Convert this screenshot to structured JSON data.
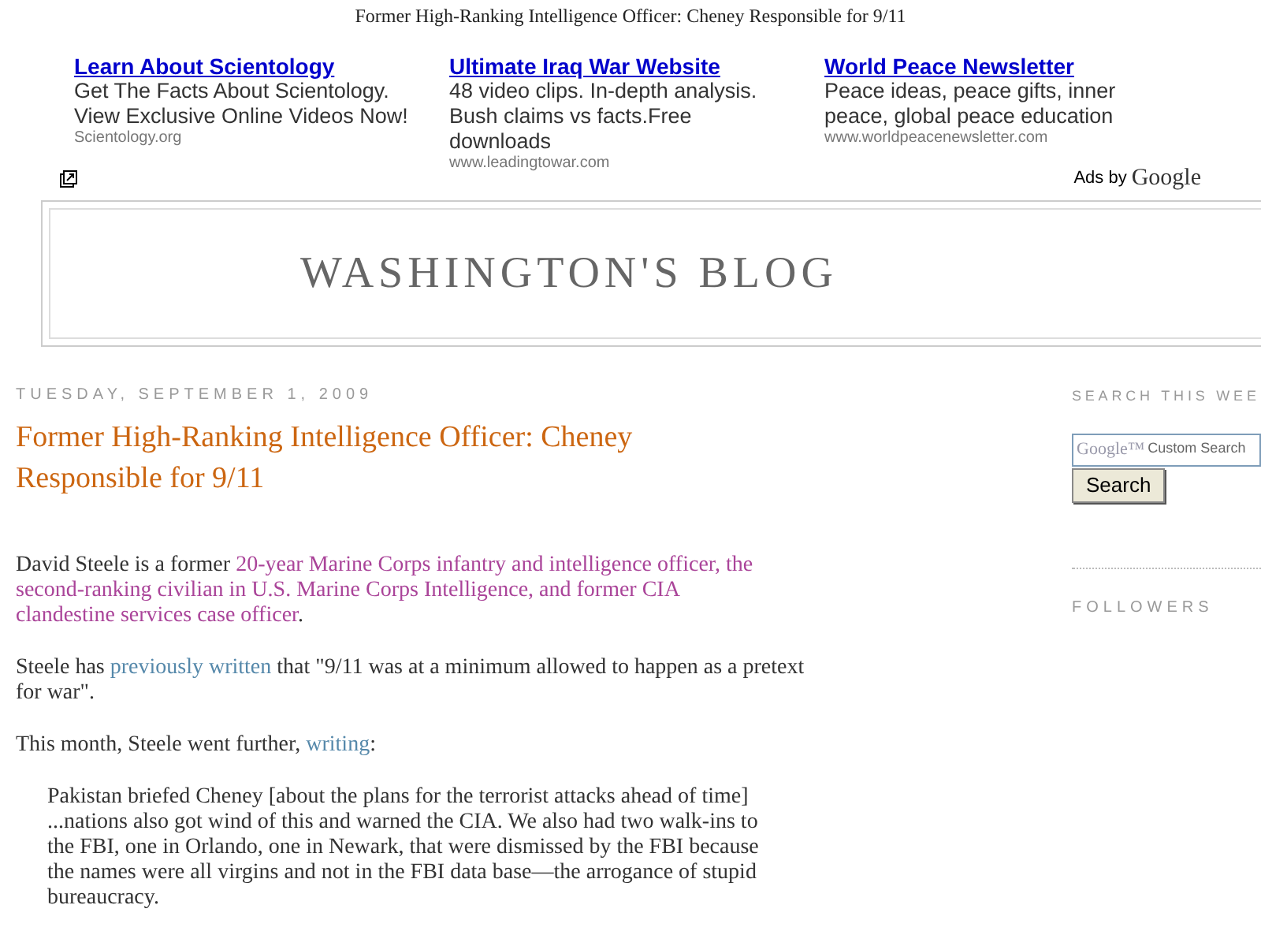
{
  "page_title": "Former High-Ranking Intelligence Officer: Cheney Responsible for 9/11",
  "ads": [
    {
      "headline": "Learn About Scientology",
      "body": "Get The Facts About Scientology. View Exclusive Online Videos Now!",
      "url": "Scientology.org"
    },
    {
      "headline": "Ultimate Iraq War Website",
      "body": "48 video clips. In-depth analysis. Bush claims vs facts.Free downloads",
      "url": "www.leadingtowar.com"
    },
    {
      "headline": "World Peace Newsletter",
      "body": "Peace ideas, peace gifts, inner peace, global peace education",
      "url": "www.worldpeacenewsletter.com"
    }
  ],
  "ads_by": {
    "label": "Ads by",
    "logo": "Google"
  },
  "blog_title": "WASHINGTON'S BLOG",
  "post": {
    "date": "TUESDAY, SEPTEMBER 1, 2009",
    "title": "Former High-Ranking Intelligence Officer: Cheney Responsible for 9/11",
    "paragraphs": [
      {
        "kind": "paragraph",
        "segments": [
          {
            "kind": "text",
            "text": "David Steele is a former "
          },
          {
            "kind": "visited_link",
            "text": "20-year Marine Corps infantry and intelligence officer, the"
          },
          {
            "kind": "visited_link",
            "text": "second-ranking civilian in U.S. Marine Corps Intelligence, and former CIA"
          },
          {
            "kind": "visited_link",
            "text": "clandestine services case officer"
          },
          {
            "kind": "text",
            "text": "."
          }
        ]
      },
      {
        "kind": "paragraph",
        "segments": [
          {
            "kind": "text",
            "text": "Steele has "
          },
          {
            "kind": "link",
            "text": "previously written"
          },
          {
            "kind": "text",
            "text": " that \"9/11 was at a minimum allowed to happen as a pretext for war\"."
          }
        ]
      },
      {
        "kind": "paragraph",
        "segments": [
          {
            "kind": "text",
            "text": "This month, Steele went further, "
          },
          {
            "kind": "link",
            "text": "writing"
          },
          {
            "kind": "text",
            "text": ":"
          }
        ]
      },
      {
        "kind": "quote",
        "segments": [
          {
            "kind": "text",
            "text": "Pakistan briefed Cheney [about the plans for the terrorist attacks ahead of time] ...nations also got wind of this and warned the CIA. We also had two walk-ins to the FBI, one in Orlando, one in Newark, that were dismissed by the FBI because the names were all virgins and not in the FBI data base—the arrogance of stupid bureaucracy."
          }
        ]
      }
    ]
  },
  "sidebar": {
    "search_heading": "SEARCH THIS WEE",
    "search_logo": "Google™",
    "search_placeholder": "Custom Search",
    "search_button": "Search",
    "followers_heading": "FOLLOWERS"
  }
}
